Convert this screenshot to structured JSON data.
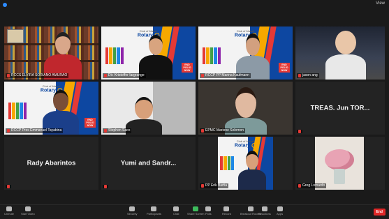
{
  "app": {
    "view_label": "View"
  },
  "tiles": [
    {
      "name": "RCCS ELVIRA SORIANO AMURAO",
      "speaker": true
    },
    {
      "name": "Dir. Kristoffer Iargrange",
      "rotary": true
    },
    {
      "name": "RCCP PP Marina Kaufmann",
      "rotary": true
    },
    {
      "name": "jason ang"
    },
    {
      "name": "RCCP Pres Emmanuel Tayabina",
      "rotary": true
    },
    {
      "name": "Stephen Saco"
    },
    {
      "name": "EPMC Marione Solomon"
    },
    {
      "name": "",
      "display": "TREAS. Jun TOR..."
    },
    {
      "name": "",
      "display": "Rady Abarintos"
    },
    {
      "name": "",
      "display": "Yumi and Sandr..."
    },
    {
      "name": "PP Erik Bartia",
      "rotary": true
    },
    {
      "name": "Greg Lomardo"
    }
  ],
  "rotary": {
    "logo_small": "Club of Makati",
    "logo": "Rotary",
    "polio": "END POLIO NOW"
  },
  "toolbar": {
    "items": [
      "Unmute",
      "Start Video",
      "Security",
      "Participants",
      "Chat",
      "Share Screen",
      "Polls",
      "Record",
      "Breakout Rooms",
      "Reactions",
      "Apps"
    ],
    "participants_count": "36",
    "end": "End"
  },
  "colors": {
    "speaker_outline": "#f4e04d",
    "end_button": "#e02828",
    "rotary_blue": "#0d47a1",
    "rotary_gold": "#f7a800"
  }
}
